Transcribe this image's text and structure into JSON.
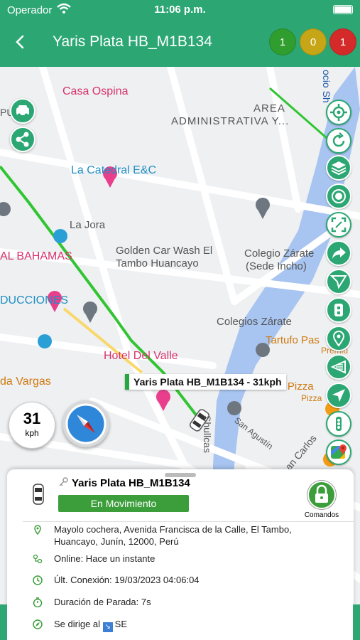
{
  "status_bar": {
    "carrier": "Operador",
    "time": "11:06 p.m."
  },
  "header": {
    "title": "Yaris Plata HB_M1B134",
    "counters": [
      {
        "value": "1",
        "color": "#2f9e2f"
      },
      {
        "value": "0",
        "color": "#c6a617"
      },
      {
        "value": "1",
        "color": "#d52a2a"
      }
    ]
  },
  "map": {
    "labels": [
      "Casa Ospina",
      "AREA",
      "ADMINISTRATIVA Y...",
      "La Catedral E&C",
      "La Jora",
      "Golden Car Wash El",
      "Tambo Huancayo",
      "Colegio Zárate",
      "(Sede Incho)",
      "AL BAHAMAS",
      "DUCCIONES",
      "Colegios Zárate",
      "Tartufo Pas",
      "Hotel Del Valle",
      "Toto's Pizza",
      "Pizza",
      "da Vargas",
      "Shullcas",
      "San Agustín",
      "an Carlos",
      "Premiu",
      "PUAS",
      "ocio Sh"
    ],
    "vehicle_label": "Yaris Plata HB_M1B134 - 31kph"
  },
  "speed": {
    "value": "31",
    "unit": "kph"
  },
  "sheet": {
    "vehicle_name": "Yaris Plata HB_M1B134",
    "state": "En Movimiento",
    "commands_label": "Comandos",
    "rows": [
      {
        "icon": "location-pin-icon",
        "text": "Mayolo cochera, Avenida Francisca de la Calle, El Tambo, Huancayo, Junín, 12000, Perú"
      },
      {
        "icon": "signal-icon",
        "text": "Online: Hace un instante"
      },
      {
        "icon": "clock-icon",
        "text": "Últ. Conexión: 19/03/2023 04:06:04"
      },
      {
        "icon": "stopwatch-icon",
        "text": "Duración de Parada: 7s"
      },
      {
        "icon": "compass-icon",
        "text": "Se dirige al",
        "direction": "SE"
      }
    ]
  },
  "colors": {
    "brand_green": "#2ca774",
    "route_green": "#31c531",
    "state_green": "#3b9e3b",
    "water_blue": "#a8c4f0"
  },
  "right_tools": [
    "crosshair-icon",
    "refresh-icon",
    "layers-icon",
    "timer-icon",
    "focus-frame-icon",
    "share-arrow-icon",
    "send-icon",
    "street-view-icon",
    "pin-icon",
    "geofence-icon",
    "navigation-arrow-icon",
    "traffic-light-icon",
    "google-maps-icon"
  ]
}
